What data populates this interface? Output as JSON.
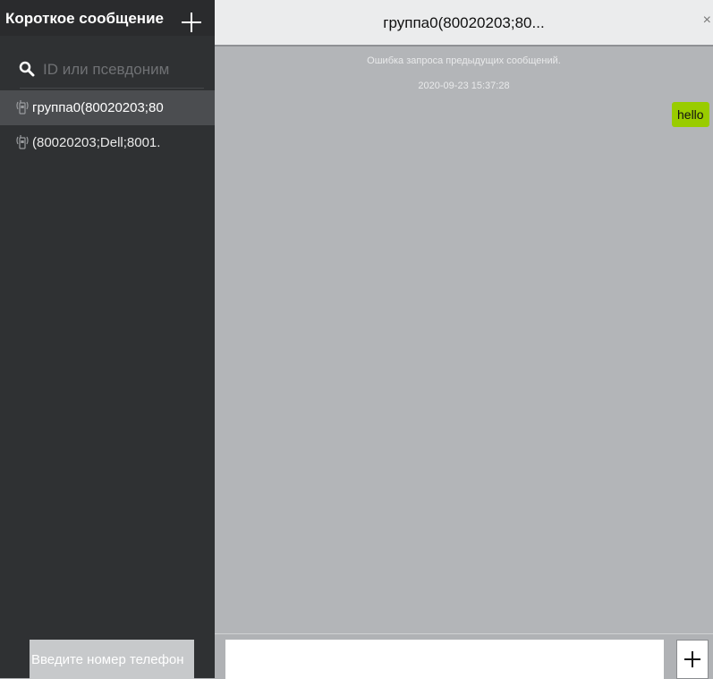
{
  "sidebar": {
    "title": "Короткое сообщение",
    "search_placeholder": "ID или псевдоним",
    "conversations": [
      {
        "label": "группа0(80020203;80",
        "icon": "walkie-talkie-icon",
        "active": true
      },
      {
        "label": "(80020203;Dell;8001.",
        "icon": "walkie-talkie-icon",
        "active": false
      }
    ],
    "phone_placeholder": "Введите номер телефон"
  },
  "chat": {
    "title": "группа0(80020203;80...",
    "close_label": "×",
    "error_notice": "Ошибка запроса предыдущих сообщений.",
    "timestamp": "2020-09-23 15:37:28",
    "messages": [
      {
        "text": "hello",
        "direction": "outgoing"
      }
    ],
    "input_value": ""
  },
  "colors": {
    "sidebar_bg": "#2f3133",
    "active_item_bg": "#4b4d50",
    "chat_bg": "#b3b5b8",
    "outgoing_bubble": "#99cc00"
  }
}
